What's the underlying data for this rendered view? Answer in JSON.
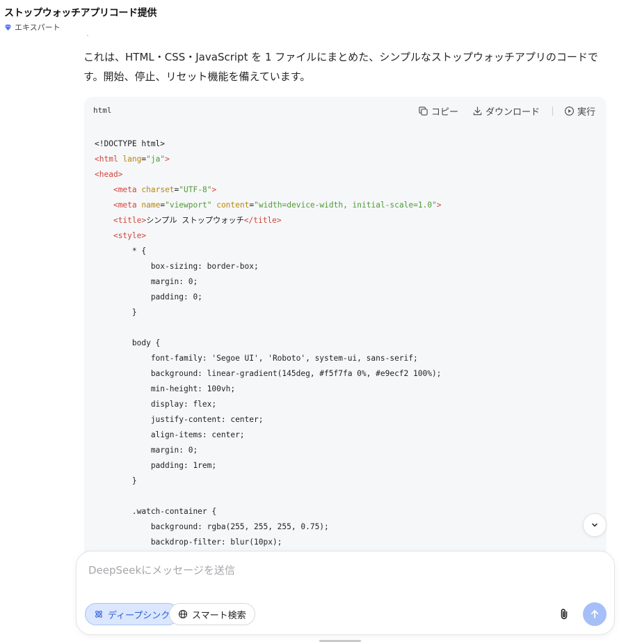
{
  "header": {
    "title": "ストップウォッチアプリコード提供",
    "badge": "エキスパート"
  },
  "message": {
    "intro": "これは、HTML・CSS・JavaScript を 1 ファイルにまとめた、シンプルなストップウォッチアプリのコードです。開始、停止、リセット機能を備えています。"
  },
  "code_block": {
    "language": "html",
    "copy_label": "コピー",
    "download_label": "ダウンロード",
    "run_label": "実行",
    "lines": [
      [
        {
          "t": "plain",
          "v": "<!DOCTYPE html>"
        }
      ],
      [
        {
          "t": "tag",
          "v": "<html"
        },
        {
          "t": "plain",
          "v": " "
        },
        {
          "t": "attr",
          "v": "lang"
        },
        {
          "t": "plain",
          "v": "="
        },
        {
          "t": "str",
          "v": "\"ja\""
        },
        {
          "t": "tag",
          "v": ">"
        }
      ],
      [
        {
          "t": "tag",
          "v": "<head>"
        }
      ],
      [
        {
          "t": "plain",
          "v": "    "
        },
        {
          "t": "tag",
          "v": "<meta"
        },
        {
          "t": "plain",
          "v": " "
        },
        {
          "t": "attr",
          "v": "charset"
        },
        {
          "t": "plain",
          "v": "="
        },
        {
          "t": "str",
          "v": "\"UTF-8\""
        },
        {
          "t": "tag",
          "v": ">"
        }
      ],
      [
        {
          "t": "plain",
          "v": "    "
        },
        {
          "t": "tag",
          "v": "<meta"
        },
        {
          "t": "plain",
          "v": " "
        },
        {
          "t": "attr",
          "v": "name"
        },
        {
          "t": "plain",
          "v": "="
        },
        {
          "t": "str",
          "v": "\"viewport\""
        },
        {
          "t": "plain",
          "v": " "
        },
        {
          "t": "attr",
          "v": "content"
        },
        {
          "t": "plain",
          "v": "="
        },
        {
          "t": "str",
          "v": "\"width=device-width, initial-scale=1.0\""
        },
        {
          "t": "tag",
          "v": ">"
        }
      ],
      [
        {
          "t": "plain",
          "v": "    "
        },
        {
          "t": "tag",
          "v": "<title>"
        },
        {
          "t": "plain",
          "v": "シンプル ストップウォッチ"
        },
        {
          "t": "tag",
          "v": "</title>"
        }
      ],
      [
        {
          "t": "plain",
          "v": "    "
        },
        {
          "t": "tag",
          "v": "<style>"
        }
      ],
      [
        {
          "t": "plain",
          "v": "        * {"
        }
      ],
      [
        {
          "t": "plain",
          "v": "            box-sizing: border-box;"
        }
      ],
      [
        {
          "t": "plain",
          "v": "            margin: 0;"
        }
      ],
      [
        {
          "t": "plain",
          "v": "            padding: 0;"
        }
      ],
      [
        {
          "t": "plain",
          "v": "        }"
        }
      ],
      [
        {
          "t": "plain",
          "v": ""
        }
      ],
      [
        {
          "t": "plain",
          "v": "        body {"
        }
      ],
      [
        {
          "t": "plain",
          "v": "            font-family: 'Segoe UI', 'Roboto', system-ui, sans-serif;"
        }
      ],
      [
        {
          "t": "plain",
          "v": "            background: linear-gradient(145deg, #f5f7fa 0%, #e9ecf2 100%);"
        }
      ],
      [
        {
          "t": "plain",
          "v": "            min-height: 100vh;"
        }
      ],
      [
        {
          "t": "plain",
          "v": "            display: flex;"
        }
      ],
      [
        {
          "t": "plain",
          "v": "            justify-content: center;"
        }
      ],
      [
        {
          "t": "plain",
          "v": "            align-items: center;"
        }
      ],
      [
        {
          "t": "plain",
          "v": "            margin: 0;"
        }
      ],
      [
        {
          "t": "plain",
          "v": "            padding: 1rem;"
        }
      ],
      [
        {
          "t": "plain",
          "v": "        }"
        }
      ],
      [
        {
          "t": "plain",
          "v": ""
        }
      ],
      [
        {
          "t": "plain",
          "v": "        .watch-container {"
        }
      ],
      [
        {
          "t": "plain",
          "v": "            background: rgba(255, 255, 255, 0.75);"
        }
      ],
      [
        {
          "t": "plain",
          "v": "            backdrop-filter: blur(10px);"
        }
      ]
    ]
  },
  "composer": {
    "placeholder": "DeepSeekにメッセージを送信",
    "deepthink_label": "ディープシンク",
    "search_label": "スマート検索"
  },
  "colors": {
    "accent": "#2f5fd0",
    "send_button": "#a7bff8",
    "tag": "#d1453b",
    "attr": "#b8860b",
    "string": "#4f9a36"
  },
  "icons": {
    "badge": "diamond-icon",
    "copy": "copy-icon",
    "download": "download-icon",
    "run": "play-circle-icon",
    "scroll": "chevron-down-icon",
    "deepthink": "atom-icon",
    "search": "globe-icon",
    "attach": "paperclip-icon",
    "send": "arrow-up-icon"
  }
}
